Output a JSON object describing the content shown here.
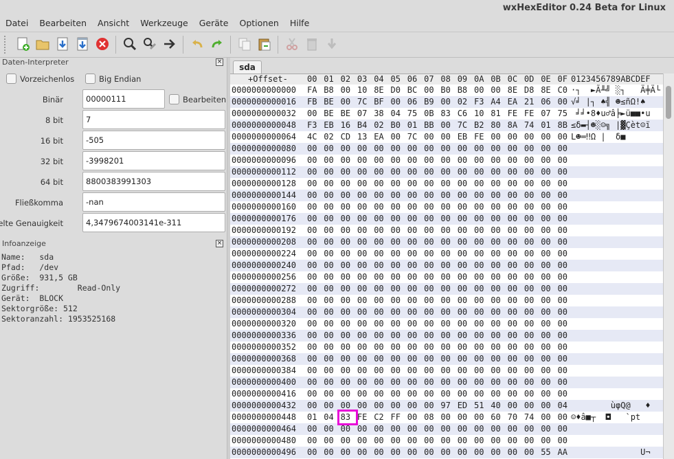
{
  "window": {
    "title": "wxHexEditor 0.24 Beta for Linux"
  },
  "menu": [
    "Datei",
    "Bearbeiten",
    "Ansicht",
    "Werkzeuge",
    "Geräte",
    "Optionen",
    "Hilfe"
  ],
  "toolbar": [
    {
      "icon": "new-file-icon"
    },
    {
      "icon": "open-folder-icon"
    },
    {
      "icon": "save-icon"
    },
    {
      "icon": "save-as-icon"
    },
    {
      "icon": "close-icon"
    },
    {
      "sep": true
    },
    {
      "icon": "search-icon"
    },
    {
      "icon": "replace-icon"
    },
    {
      "icon": "goto-arrow-icon"
    },
    {
      "sep": true
    },
    {
      "icon": "undo-icon"
    },
    {
      "icon": "redo-icon"
    },
    {
      "sep": true
    },
    {
      "icon": "copy-icon"
    },
    {
      "icon": "paste-icon"
    },
    {
      "sep": true
    },
    {
      "icon": "cut-icon"
    },
    {
      "icon": "delete-icon"
    },
    {
      "icon": "insert-icon"
    }
  ],
  "interpreter": {
    "title": "Daten-Interpreter",
    "unsigned_label": "Vorzeichenlos",
    "big_endian_label": "Big Endian",
    "edit_label": "Bearbeiten",
    "rows": [
      {
        "label": "Binär",
        "value": "00000111"
      },
      {
        "label": "8 bit",
        "value": "7"
      },
      {
        "label": "16 bit",
        "value": "-505"
      },
      {
        "label": "32 bit",
        "value": "-3998201"
      },
      {
        "label": "64 bit",
        "value": "8800383991303"
      },
      {
        "label": "Fließkomma",
        "value": "-nan"
      },
      {
        "label": "Doppelte Genauigkeit",
        "value": "4,3479674003141e-311"
      }
    ]
  },
  "info": {
    "title": "Infoanzeige",
    "lines": [
      "Name:   sda",
      "Pfad:   /dev",
      "Größe:  931,5 GB",
      "Zugriff:        Read-Only",
      "Gerät:  BLOCK",
      "Sektorgröße: 512",
      "Sektoranzahl: 1953525168"
    ]
  },
  "hex": {
    "tab": "sda",
    "header_offset": "+Offset-",
    "header_cols": [
      "00",
      "01",
      "02",
      "03",
      "04",
      "05",
      "06",
      "07",
      "08",
      "09",
      "0A",
      "0B",
      "0C",
      "0D",
      "0E",
      "0F"
    ],
    "header_text": "0123456789ABCDEF",
    "selected": {
      "row": 28,
      "col": 2
    },
    "rows": [
      {
        "offset": "0000000000000",
        "bytes": "FA B8 00 10 8E D0 BC 00 B0 B8 00 00 8E D8 8E C0",
        "text": "·┐  ►Ã╨╝ ░┐   Ä╪Ä└"
      },
      {
        "offset": "0000000000016",
        "bytes": "FB BE 00 7C BF 00 06 B9 00 02 F3 A4 EA 21 06 00",
        "text": "√╛ |┐ ♠╣ ☻≤ñΩ!♠"
      },
      {
        "offset": "0000000000032",
        "bytes": "00 BE BE 07 38 04 75 0B 83 C6 10 81 FE FE 07 75",
        "text": " ╛╛•8♦u♂â╞►ü■■•u"
      },
      {
        "offset": "0000000000048",
        "bytes": "F3 EB 16 B4 02 B0 01 BB 00 7C B2 80 8A 74 01 8B",
        "text": "≤δ▬┤☻░☺╗ |▓Çèt☺ï"
      },
      {
        "offset": "0000000000064",
        "bytes": "4C 02 CD 13 EA 00 7C 00 00 EB FE 00 00 00 00 00",
        "text": "L☻═‼Ω |  δ■     "
      },
      {
        "offset": "0000000000080",
        "bytes": "00 00 00 00 00 00 00 00 00 00 00 00 00 00 00 00",
        "text": ""
      },
      {
        "offset": "0000000000096",
        "bytes": "00 00 00 00 00 00 00 00 00 00 00 00 00 00 00 00",
        "text": ""
      },
      {
        "offset": "0000000000112",
        "bytes": "00 00 00 00 00 00 00 00 00 00 00 00 00 00 00 00",
        "text": ""
      },
      {
        "offset": "0000000000128",
        "bytes": "00 00 00 00 00 00 00 00 00 00 00 00 00 00 00 00",
        "text": ""
      },
      {
        "offset": "0000000000144",
        "bytes": "00 00 00 00 00 00 00 00 00 00 00 00 00 00 00 00",
        "text": ""
      },
      {
        "offset": "0000000000160",
        "bytes": "00 00 00 00 00 00 00 00 00 00 00 00 00 00 00 00",
        "text": ""
      },
      {
        "offset": "0000000000176",
        "bytes": "00 00 00 00 00 00 00 00 00 00 00 00 00 00 00 00",
        "text": ""
      },
      {
        "offset": "0000000000192",
        "bytes": "00 00 00 00 00 00 00 00 00 00 00 00 00 00 00 00",
        "text": ""
      },
      {
        "offset": "0000000000208",
        "bytes": "00 00 00 00 00 00 00 00 00 00 00 00 00 00 00 00",
        "text": ""
      },
      {
        "offset": "0000000000224",
        "bytes": "00 00 00 00 00 00 00 00 00 00 00 00 00 00 00 00",
        "text": ""
      },
      {
        "offset": "0000000000240",
        "bytes": "00 00 00 00 00 00 00 00 00 00 00 00 00 00 00 00",
        "text": ""
      },
      {
        "offset": "0000000000256",
        "bytes": "00 00 00 00 00 00 00 00 00 00 00 00 00 00 00 00",
        "text": ""
      },
      {
        "offset": "0000000000272",
        "bytes": "00 00 00 00 00 00 00 00 00 00 00 00 00 00 00 00",
        "text": ""
      },
      {
        "offset": "0000000000288",
        "bytes": "00 00 00 00 00 00 00 00 00 00 00 00 00 00 00 00",
        "text": ""
      },
      {
        "offset": "0000000000304",
        "bytes": "00 00 00 00 00 00 00 00 00 00 00 00 00 00 00 00",
        "text": ""
      },
      {
        "offset": "0000000000320",
        "bytes": "00 00 00 00 00 00 00 00 00 00 00 00 00 00 00 00",
        "text": ""
      },
      {
        "offset": "0000000000336",
        "bytes": "00 00 00 00 00 00 00 00 00 00 00 00 00 00 00 00",
        "text": ""
      },
      {
        "offset": "0000000000352",
        "bytes": "00 00 00 00 00 00 00 00 00 00 00 00 00 00 00 00",
        "text": ""
      },
      {
        "offset": "0000000000368",
        "bytes": "00 00 00 00 00 00 00 00 00 00 00 00 00 00 00 00",
        "text": ""
      },
      {
        "offset": "0000000000384",
        "bytes": "00 00 00 00 00 00 00 00 00 00 00 00 00 00 00 00",
        "text": ""
      },
      {
        "offset": "0000000000400",
        "bytes": "00 00 00 00 00 00 00 00 00 00 00 00 00 00 00 00",
        "text": ""
      },
      {
        "offset": "0000000000416",
        "bytes": "00 00 00 00 00 00 00 00 00 00 00 00 00 00 00 00",
        "text": ""
      },
      {
        "offset": "0000000000432",
        "bytes": "00 00 00 00 00 00 00 00 97 ED 51 40 00 00 00 04",
        "text": "        ùφQ@   ♦"
      },
      {
        "offset": "0000000000448",
        "bytes": "01 04 83 FE C2 FF 00 08 00 00 00 60 70 74 00 00",
        "text": "☺♦â■┬  ◘   `pt  "
      },
      {
        "offset": "0000000000464",
        "bytes": "00 00 00 00 00 00 00 00 00 00 00 00 00 00 00 00",
        "text": ""
      },
      {
        "offset": "0000000000480",
        "bytes": "00 00 00 00 00 00 00 00 00 00 00 00 00 00 00 00",
        "text": ""
      },
      {
        "offset": "0000000000496",
        "bytes": "00 00 00 00 00 00 00 00 00 00 00 00 00 00 55 AA",
        "text": "              U¬"
      }
    ]
  },
  "colors": {
    "highlight_box": "#e80ad8",
    "row_alt": "#e6e9f5"
  }
}
